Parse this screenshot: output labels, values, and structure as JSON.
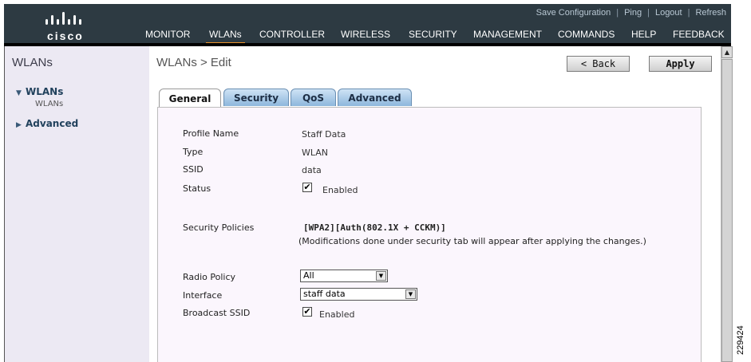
{
  "header": {
    "brand": "cisco",
    "top_links": {
      "save_configuration": "Save Configuration",
      "ping": "Ping",
      "logout": "Logout",
      "refresh": "Refresh",
      "separator": "|"
    },
    "nav": [
      "MONITOR",
      "WLANs",
      "CONTROLLER",
      "WIRELESS",
      "SECURITY",
      "MANAGEMENT",
      "COMMANDS",
      "HELP",
      "FEEDBACK"
    ],
    "active_nav": "WLANs"
  },
  "sidebar": {
    "title": "WLANs",
    "items": [
      {
        "label": "WLANs",
        "expanded": true,
        "children": [
          "WLANs"
        ]
      },
      {
        "label": "Advanced",
        "expanded": false,
        "children": []
      }
    ]
  },
  "main": {
    "page_title": "WLANs > Edit",
    "back_label": "< Back",
    "apply_label": "Apply",
    "tabs": [
      "General",
      "Security",
      "QoS",
      "Advanced"
    ],
    "active_tab": "General",
    "fields": {
      "profile_name": {
        "label": "Profile Name",
        "value": "Staff Data"
      },
      "type": {
        "label": "Type",
        "value": "WLAN"
      },
      "ssid": {
        "label": "SSID",
        "value": "data"
      },
      "status": {
        "label": "Status",
        "checkbox_label": "Enabled",
        "checked": true
      },
      "security_policies": {
        "label": "Security Policies",
        "value": "[WPA2][Auth(802.1X + CCKM)]",
        "note": "(Modifications done under security tab will appear after applying the changes.)"
      },
      "radio_policy": {
        "label": "Radio Policy",
        "selected": "All"
      },
      "interface": {
        "label": "Interface",
        "selected": "staff data"
      },
      "broadcast_ssid": {
        "label": "Broadcast SSID",
        "checkbox_label": "Enabled",
        "checked": true
      }
    }
  },
  "figure_id": "229424",
  "colors": {
    "header_bg": "#2d3a42",
    "nav_active_underline": "#e8922b",
    "sidebar_bg": "#ece9f3",
    "panel_bg": "#fbf6fd",
    "tab_bg": "#8db7dc"
  }
}
